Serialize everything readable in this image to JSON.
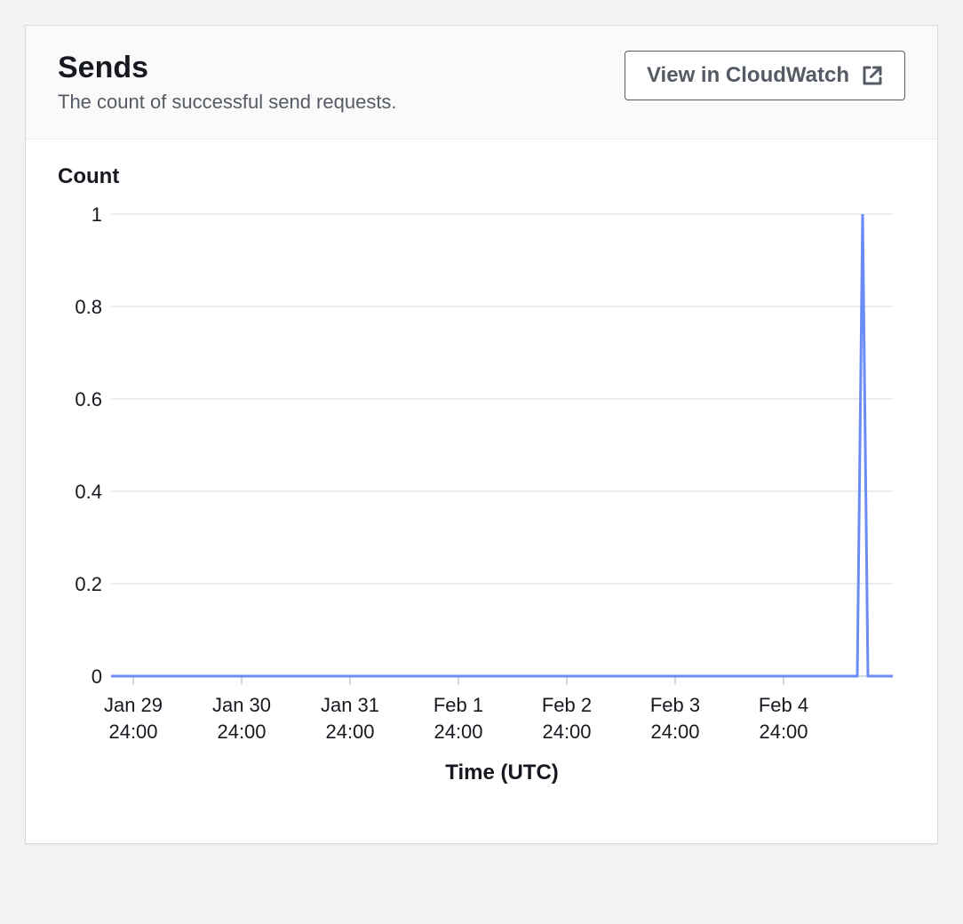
{
  "header": {
    "title": "Sends",
    "subtitle": "The count of successful send requests.",
    "view_button_label": "View in CloudWatch"
  },
  "chart_data": {
    "type": "line",
    "title": "",
    "ylabel": "Count",
    "xlabel": "Time (UTC)",
    "ylim": [
      0,
      1
    ],
    "y_ticks": [
      "0",
      "0.2",
      "0.4",
      "0.6",
      "0.8",
      "1"
    ],
    "x_tick_labels": [
      {
        "line1": "Jan 29",
        "line2": "24:00"
      },
      {
        "line1": "Jan 30",
        "line2": "24:00"
      },
      {
        "line1": "Jan 31",
        "line2": "24:00"
      },
      {
        "line1": "Feb 1",
        "line2": "24:00"
      },
      {
        "line1": "Feb 2",
        "line2": "24:00"
      },
      {
        "line1": "Feb 3",
        "line2": "24:00"
      },
      {
        "line1": "Feb 4",
        "line2": "24:00"
      }
    ],
    "series": [
      {
        "name": "Sends",
        "color": "#6b8cf5",
        "x": [
          "Jan 29 24:00",
          "Jan 30 24:00",
          "Jan 31 24:00",
          "Feb 1 24:00",
          "Feb 2 24:00",
          "Feb 3 24:00",
          "Feb 4 24:00",
          "Feb 5 12:00",
          "Feb 5 13:00",
          "Feb 5 14:00"
        ],
        "values": [
          0,
          0,
          0,
          0,
          0,
          0,
          0,
          0,
          1,
          0
        ]
      }
    ]
  }
}
